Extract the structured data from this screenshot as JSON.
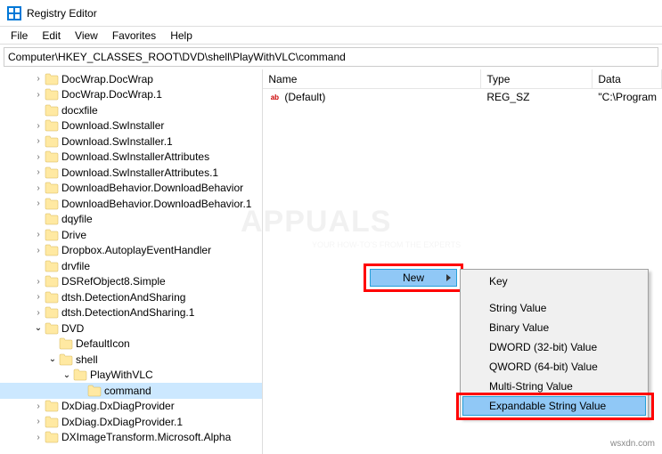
{
  "window": {
    "title": "Registry Editor"
  },
  "menu": {
    "file": "File",
    "edit": "Edit",
    "view": "View",
    "favorites": "Favorites",
    "help": "Help"
  },
  "address": "Computer\\HKEY_CLASSES_ROOT\\DVD\\shell\\PlayWithVLC\\command",
  "tree": [
    {
      "indent": 2,
      "twisty": ">",
      "label": "DocWrap.DocWrap"
    },
    {
      "indent": 2,
      "twisty": ">",
      "label": "DocWrap.DocWrap.1"
    },
    {
      "indent": 2,
      "twisty": "",
      "label": "docxfile"
    },
    {
      "indent": 2,
      "twisty": ">",
      "label": "Download.SwInstaller"
    },
    {
      "indent": 2,
      "twisty": ">",
      "label": "Download.SwInstaller.1"
    },
    {
      "indent": 2,
      "twisty": ">",
      "label": "Download.SwInstallerAttributes"
    },
    {
      "indent": 2,
      "twisty": ">",
      "label": "Download.SwInstallerAttributes.1"
    },
    {
      "indent": 2,
      "twisty": ">",
      "label": "DownloadBehavior.DownloadBehavior"
    },
    {
      "indent": 2,
      "twisty": ">",
      "label": "DownloadBehavior.DownloadBehavior.1"
    },
    {
      "indent": 2,
      "twisty": "",
      "label": "dqyfile"
    },
    {
      "indent": 2,
      "twisty": ">",
      "label": "Drive"
    },
    {
      "indent": 2,
      "twisty": ">",
      "label": "Dropbox.AutoplayEventHandler"
    },
    {
      "indent": 2,
      "twisty": "",
      "label": "drvfile"
    },
    {
      "indent": 2,
      "twisty": ">",
      "label": "DSRefObject8.Simple"
    },
    {
      "indent": 2,
      "twisty": ">",
      "label": "dtsh.DetectionAndSharing"
    },
    {
      "indent": 2,
      "twisty": ">",
      "label": "dtsh.DetectionAndSharing.1"
    },
    {
      "indent": 2,
      "twisty": "v",
      "label": "DVD"
    },
    {
      "indent": 3,
      "twisty": "",
      "label": "DefaultIcon"
    },
    {
      "indent": 3,
      "twisty": "v",
      "label": "shell"
    },
    {
      "indent": 4,
      "twisty": "v",
      "label": "PlayWithVLC"
    },
    {
      "indent": 5,
      "twisty": "",
      "label": "command",
      "selected": true
    },
    {
      "indent": 2,
      "twisty": ">",
      "label": "DxDiag.DxDiagProvider"
    },
    {
      "indent": 2,
      "twisty": ">",
      "label": "DxDiag.DxDiagProvider.1"
    },
    {
      "indent": 2,
      "twisty": ">",
      "label": "DXImageTransform.Microsoft.Alpha"
    }
  ],
  "columns": {
    "name": "Name",
    "type": "Type",
    "data": "Data"
  },
  "values": [
    {
      "name": "(Default)",
      "type": "REG_SZ",
      "data": "\"C:\\Program"
    }
  ],
  "context_sub": {
    "label": "New"
  },
  "context_menu": [
    {
      "label": "Key"
    },
    {
      "label": "String Value"
    },
    {
      "label": "Binary Value"
    },
    {
      "label": "DWORD (32-bit) Value"
    },
    {
      "label": "QWORD (64-bit) Value"
    },
    {
      "label": "Multi-String Value"
    },
    {
      "label": "Expandable String Value",
      "highlighted": true
    }
  ],
  "watermark": "wsxdn.com",
  "wm_brand": "APPUALS",
  "wm_sub": "YOUR HOW-TO'S FROM THE EXPERTS"
}
